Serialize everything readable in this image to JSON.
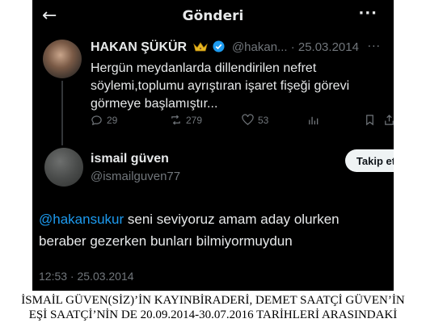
{
  "header": {
    "back_icon": "back-arrow-icon",
    "title": "Gönderi",
    "more_icon": "more-icon"
  },
  "quoted_post": {
    "author_name": "HAKAN ŞÜKÜR",
    "badge_icons": [
      "crown-icon",
      "verified-badge-icon"
    ],
    "verified_color": "#1d9bf0",
    "handle_date": "@hakan... · 25.03.2014",
    "more": "···",
    "text": "Hergün meydanlarda dillendirilen nefret söylemi,toplumu ayrıştıran işaret fişeği görevi görmeye başlamıştır...",
    "replies": "29",
    "reposts": "279",
    "likes": "53"
  },
  "reply_post": {
    "author_name": "ismail güven",
    "handle": "@ismailguven77",
    "follow_label": "Takip et",
    "mention": "@hakansukur",
    "text": " seni seviyoruz amam aday olurken beraber gezerken bunları bilmiyormuydun",
    "timestamp": "12:53 · 25.03.2014",
    "mention_color": "#1d9bf0"
  },
  "caption": {
    "line1": "İSMAİL GÜVEN(SİZ)’İN KAYINBİRADERİ, DEMET SAATÇİ GÜVEN’İN",
    "line2": "EŞİ SAATÇİ’NİN DE 20.09.2014-30.07.2016 TARİHLERİ ARASINDAKİ"
  }
}
